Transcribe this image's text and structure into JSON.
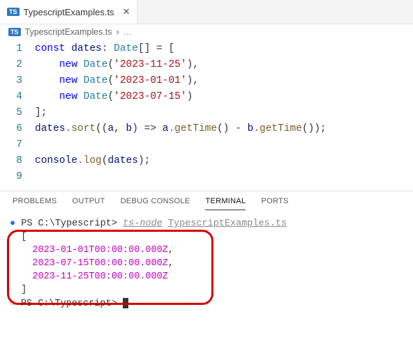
{
  "tab": {
    "badge": "TS",
    "filename": "TypescriptExamples.ts",
    "close_glyph": "✕"
  },
  "breadcrumb": {
    "badge": "TS",
    "filename": "TypescriptExamples.ts",
    "sep": "›",
    "more": "…"
  },
  "lines": [
    "1",
    "2",
    "3",
    "4",
    "5",
    "6",
    "7",
    "8",
    "9"
  ],
  "code": {
    "l1_const": "const",
    "l1_dates": " dates",
    "l1_colon": ": ",
    "l1_date": "Date",
    "l1_arr": "[] = [",
    "l2_new": "new",
    "l2_date": " Date",
    "l2_str": "'2023-11-25'",
    "l3_str": "'2023-01-01'",
    "l4_str": "'2023-07-15'",
    "l5": "];",
    "l6_dates": "dates",
    "l6_sort": ".sort",
    "l6_args": "((",
    "l6_a": "a",
    "l6_comma": ", ",
    "l6_b": "b",
    "l6_arrow": ") => ",
    "l6_a2": "a",
    "l6_gt1": ".getTime",
    "l6_mid": "() - ",
    "l6_b2": "b",
    "l6_gt2": ".getTime",
    "l6_end": "());",
    "l8_console": "console",
    "l8_log": ".log",
    "l8_open": "(",
    "l8_dates": "dates",
    "l8_close": ");"
  },
  "panel": {
    "problems": "PROBLEMS",
    "output": "OUTPUT",
    "debug": "DEBUG CONSOLE",
    "terminal": "TERMINAL",
    "ports": "PORTS"
  },
  "term": {
    "ps1": "PS ",
    "cwd": "C:\\Typescript",
    "gt": "> ",
    "cmd_node": "ts-node",
    "cmd_sp": " ",
    "cmd_file": "TypescriptExamples.ts",
    "bracket_open": "[",
    "out1": "2023-01-01T00:00:00.000Z",
    "out2": "2023-07-15T00:00:00.000Z",
    "out3": "2023-11-25T00:00:00.000Z",
    "comma": ",",
    "bracket_close": "]"
  }
}
